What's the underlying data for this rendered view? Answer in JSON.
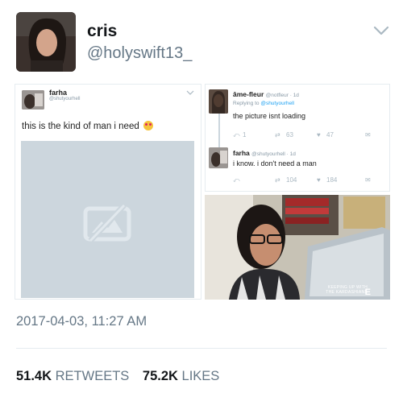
{
  "tweet": {
    "display_name": "cris",
    "handle": "@holyswift13_",
    "timestamp": "2017-04-03, 11:27 AM",
    "retweets_count": "51.4K",
    "retweets_label": "RETWEETS",
    "likes_count": "75.2K",
    "likes_label": "LIKES"
  },
  "embedded_tweet": {
    "name": "farha",
    "handle": "@shutyourhell",
    "text": "this is the kind of man i need"
  },
  "replies": [
    {
      "name": "âme-fleur",
      "meta": "@notfleur · 1d",
      "replying_prefix": "Replying to",
      "replying_to": "@shutyourhell",
      "text": "the picture isnt loading",
      "replies": "1",
      "retweets": "63",
      "likes": "47"
    },
    {
      "name": "farha",
      "meta": "@shutyourhell · 1d",
      "text": "i know. i don't need a man",
      "retweets": "104",
      "likes": "184"
    }
  ],
  "photo_caption_line1": "KEEPING UP WITH",
  "photo_caption_line2": "THE KARDASHIANS",
  "photo_caption_network": "E",
  "colors": {
    "text": "#14171a",
    "secondary": "#657786",
    "link": "#1da1f2",
    "placeholder": "#ccd6dd"
  },
  "icons": {
    "menu": "chevron-down-icon",
    "broken_image": "broken-image-icon",
    "reply": "reply-icon",
    "retweet": "retweet-icon",
    "like": "heart-icon",
    "dm": "envelope-icon"
  }
}
